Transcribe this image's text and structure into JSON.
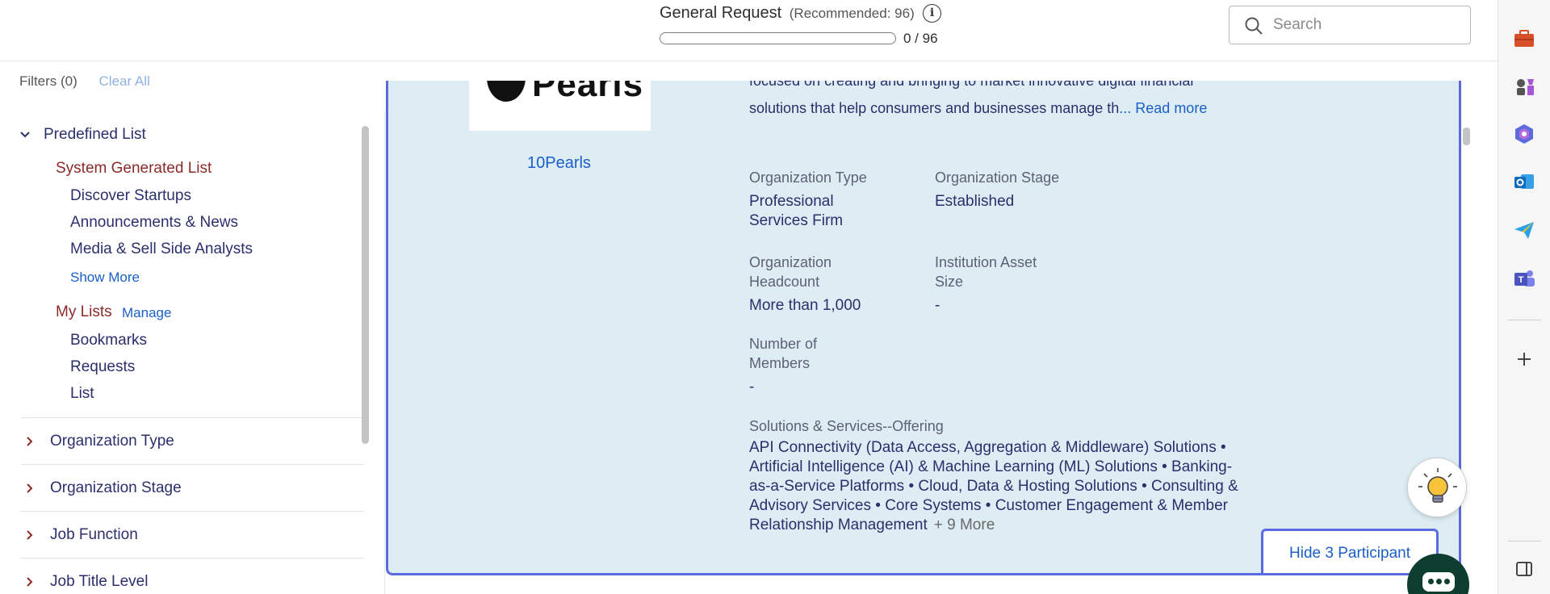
{
  "header": {
    "request_title": "General Request",
    "recommended": "(Recommended: 96)",
    "progress_value": 0,
    "progress_max": 96,
    "progress_text": "0 / 96",
    "search_placeholder": "Search"
  },
  "filters": {
    "label": "Filters (0)",
    "clear_all": "Clear All"
  },
  "sidebar": {
    "predefined_title": "Predefined List",
    "system_generated_title": "System Generated List",
    "system_items": [
      "Discover Startups",
      "Announcements & News",
      "Media & Sell Side Analysts"
    ],
    "show_more": "Show More",
    "my_lists_title": "My Lists",
    "manage": "Manage",
    "my_list_items": [
      "Bookmarks",
      "Requests",
      "List"
    ],
    "groups": [
      "Organization Type",
      "Organization Stage",
      "Job Function",
      "Job Title Level"
    ]
  },
  "card": {
    "logo_text": "Pearls",
    "org_name": "10Pearls",
    "desc_line1": "focused on creating and bringing to market innovative digital financial",
    "desc_line2": "solutions that help consumers and businesses manage th",
    "read_more": "... Read more",
    "org_type_label": "Organization Type",
    "org_type_value": "Professional Services Firm",
    "org_stage_label": "Organization Stage",
    "org_stage_value": "Established",
    "headcount_label": "Organization Headcount",
    "headcount_value": "More than 1,000",
    "asset_label": "Institution Asset Size",
    "asset_value": "-",
    "members_label": "Number of Members",
    "members_value": "-",
    "offering_label": "Solutions & Services--Offering",
    "offering_text": "API Connectivity (Data Access, Aggregation & Middleware) Solutions • Artificial Intelligence (AI) & Machine Learning (ML) Solutions • Banking-as-a-Service Platforms • Cloud, Data & Hosting Solutions • Consulting & Advisory Services • Core Systems • Customer Engagement & Member Relationship Management",
    "offering_more": "+ 9 More",
    "hide_button": "Hide 3 Participant"
  },
  "right_rail": {
    "icons": [
      "briefcase-icon",
      "chess-icon",
      "copilot-icon",
      "outlook-icon",
      "send-icon",
      "teams-icon",
      "add-icon",
      "sidebar-toggle-icon"
    ]
  },
  "colors": {
    "accent": "#5b6bdd",
    "link": "#1a5fc8",
    "card_bg": "#deecf4",
    "section_red": "#8c2a2a",
    "text_navy": "#2b2f6b"
  }
}
